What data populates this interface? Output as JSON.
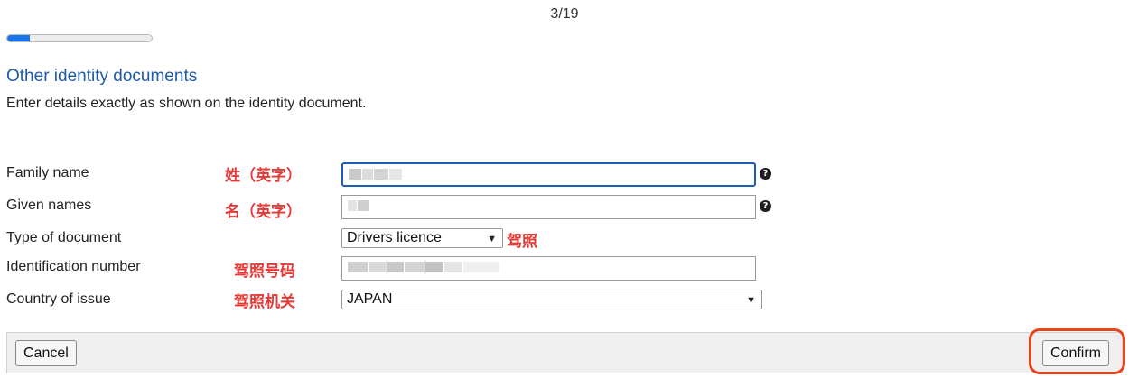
{
  "progress": {
    "text": "3/19",
    "fraction": 0.158
  },
  "section": {
    "title": "Other identity documents",
    "instructions": "Enter details exactly as shown on the identity document."
  },
  "fields": {
    "family_name": {
      "label": "Family name",
      "annotation": "姓（英字）",
      "help_icon": "question-circle-icon"
    },
    "given_names": {
      "label": "Given names",
      "annotation": "名（英字）",
      "help_icon": "question-circle-icon"
    },
    "document_type": {
      "label": "Type of document",
      "selected": "Drivers licence",
      "annotation": "驾照"
    },
    "id_number": {
      "label": "Identification number",
      "annotation": "驾照号码"
    },
    "country": {
      "label": "Country of issue",
      "selected": "JAPAN",
      "annotation": "驾照机关"
    }
  },
  "footer": {
    "cancel_label": "Cancel",
    "confirm_label": "Confirm"
  },
  "colors": {
    "accent": "#1a73e8",
    "title": "#1f5aa6",
    "annotation": "#e53935",
    "highlight": "#e8421f"
  }
}
